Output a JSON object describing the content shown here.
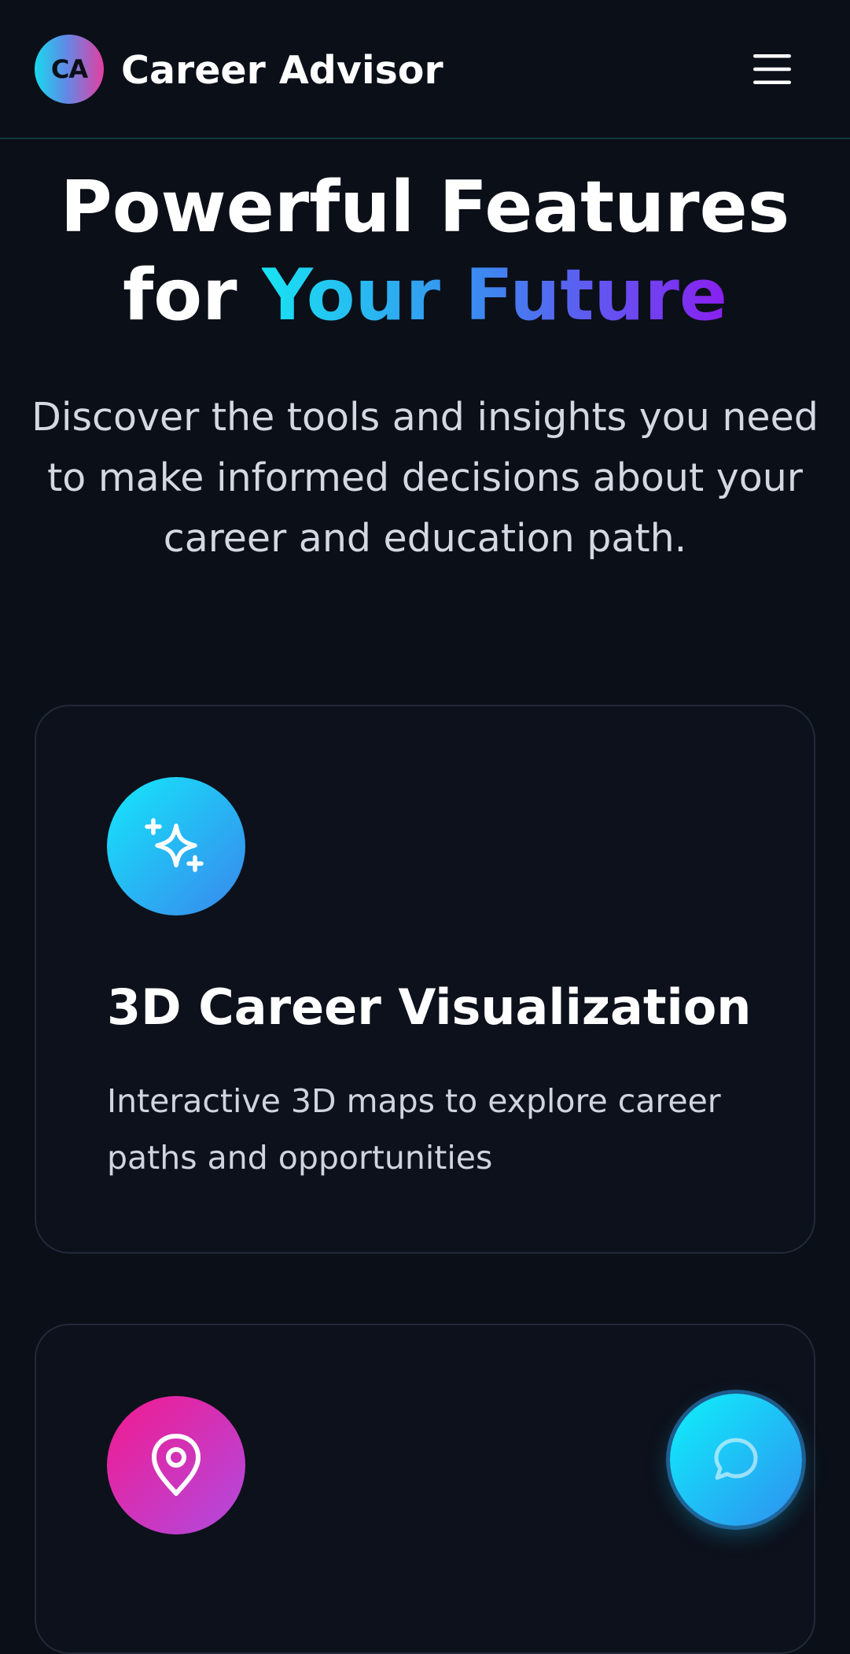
{
  "header": {
    "logo_initials": "CA",
    "brand_name": "Career Advisor",
    "menu_icon": "hamburger-menu-icon"
  },
  "hero": {
    "title_line1": "Powerful Features",
    "title_for": "for ",
    "title_highlight": "Your Future",
    "subtitle": "Discover the tools and insights you need to make informed decisions about your career and education path."
  },
  "features": [
    {
      "icon": "sparkles-icon",
      "title": "3D Career Visualization",
      "description": "Interactive 3D maps to explore career paths and opportunities"
    },
    {
      "icon": "map-pin-icon",
      "title": "",
      "description": ""
    }
  ],
  "chat": {
    "icon": "chat-bubble-icon"
  },
  "colors": {
    "background": "#0b0f18",
    "card_background": "#0d111b",
    "card_border": "#222938",
    "accent_cyan": "#18e3f2",
    "accent_blue": "#3a8df0",
    "accent_purple": "#8a1ff0",
    "accent_pink": "#f21a8f"
  }
}
